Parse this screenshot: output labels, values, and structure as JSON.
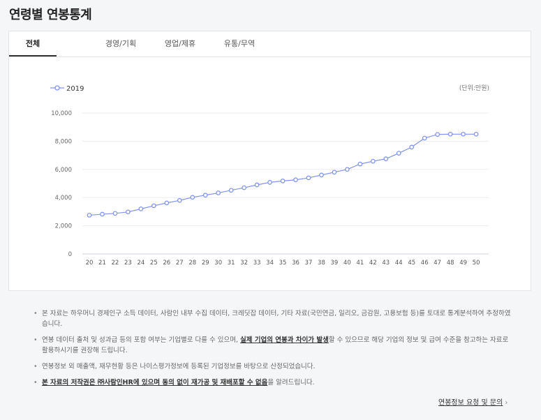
{
  "page": {
    "title": "연령별 연봉통계"
  },
  "tabs": [
    {
      "label": "전체",
      "active": true
    },
    {
      "label": "경영/기획",
      "active": false
    },
    {
      "label": "영업/제휴",
      "active": false
    },
    {
      "label": "유통/무역",
      "active": false
    }
  ],
  "chart_data": {
    "type": "line",
    "title": "",
    "unit_label": "(단위:만원)",
    "xlabel": "",
    "ylabel": "",
    "categories": [
      "20",
      "21",
      "22",
      "23",
      "24",
      "25",
      "26",
      "27",
      "28",
      "29",
      "30",
      "31",
      "32",
      "33",
      "34",
      "35",
      "36",
      "37",
      "38",
      "39",
      "40",
      "41",
      "42",
      "43",
      "44",
      "45",
      "46",
      "47",
      "48",
      "49",
      "50"
    ],
    "series": [
      {
        "name": "2019",
        "color": "#8194ee",
        "values": [
          2750,
          2820,
          2880,
          2980,
          3200,
          3420,
          3620,
          3800,
          4020,
          4170,
          4330,
          4520,
          4700,
          4900,
          5080,
          5180,
          5260,
          5400,
          5600,
          5800,
          6000,
          6380,
          6580,
          6750,
          7150,
          7580,
          8220,
          8480,
          8500,
          8500,
          8500
        ]
      }
    ],
    "ylim": [
      0,
      10000
    ],
    "yticks": [
      "0",
      "2,000",
      "4,000",
      "6,000",
      "8,000",
      "10,000"
    ],
    "grid": true,
    "legend_position": "top-left"
  },
  "notes": [
    {
      "parts": [
        {
          "text": "본 자료는 하우머니 경제인구 소득 데이터, 사람인 내부 수집 데이터, 크레딧잡 데이터, 기타 자료(국민연금, 일리오, 금감원, 고용보험 등)를 토대로 통계분석하여 추정하였습니다.",
          "bold": false
        }
      ]
    },
    {
      "parts": [
        {
          "text": "연봉 데이터 출처 및 성과급 등의 포함 여부는 기업별로 다를 수 있으며, ",
          "bold": false
        },
        {
          "text": "실제 기업의 연봉과 차이가 발생",
          "bold": true
        },
        {
          "text": "할 수 있으므로 해당 기업의 정보 및 급여 수준을 참고하는 자료로 활용하시기를 권장해 드립니다.",
          "bold": false
        }
      ]
    },
    {
      "parts": [
        {
          "text": "연봉정보 외 매출액, 재무현황 등은 나이스평가정보에 등록된 기업정보를 바탕으로 산정되었습니다.",
          "bold": false
        }
      ]
    },
    {
      "parts": [
        {
          "text": "본 자료의 저작권은 ㈜사람인HR에 있으며 동의 없이 재가공 및 재배포할 수 없음",
          "bold": true
        },
        {
          "text": "을 알려드립니다.",
          "bold": false
        }
      ]
    }
  ],
  "footer": {
    "link_label": "연봉정보 요청 및 문의",
    "chevron": "›"
  }
}
